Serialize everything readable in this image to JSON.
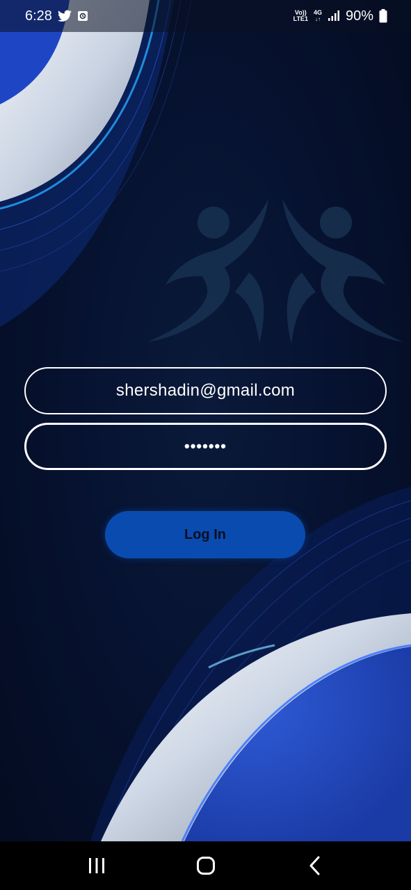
{
  "status_bar": {
    "time": "6:28",
    "network_top": "Vo))",
    "network_bottom": "LTE1",
    "network_type": "4G",
    "battery": "90%",
    "icons": [
      "twitter-icon",
      "app-notification-icon",
      "signal-icon",
      "battery-icon"
    ]
  },
  "login": {
    "email_value": "shershadin@gmail.com",
    "password_mask": "•••••••",
    "button_label": "Log In"
  },
  "nav_bar": {
    "icons": [
      "recent-apps-icon",
      "home-icon",
      "back-icon"
    ]
  },
  "colors": {
    "background": "#061230",
    "accent_blue": "#0a4bb0",
    "field_border": "#ffffff"
  }
}
